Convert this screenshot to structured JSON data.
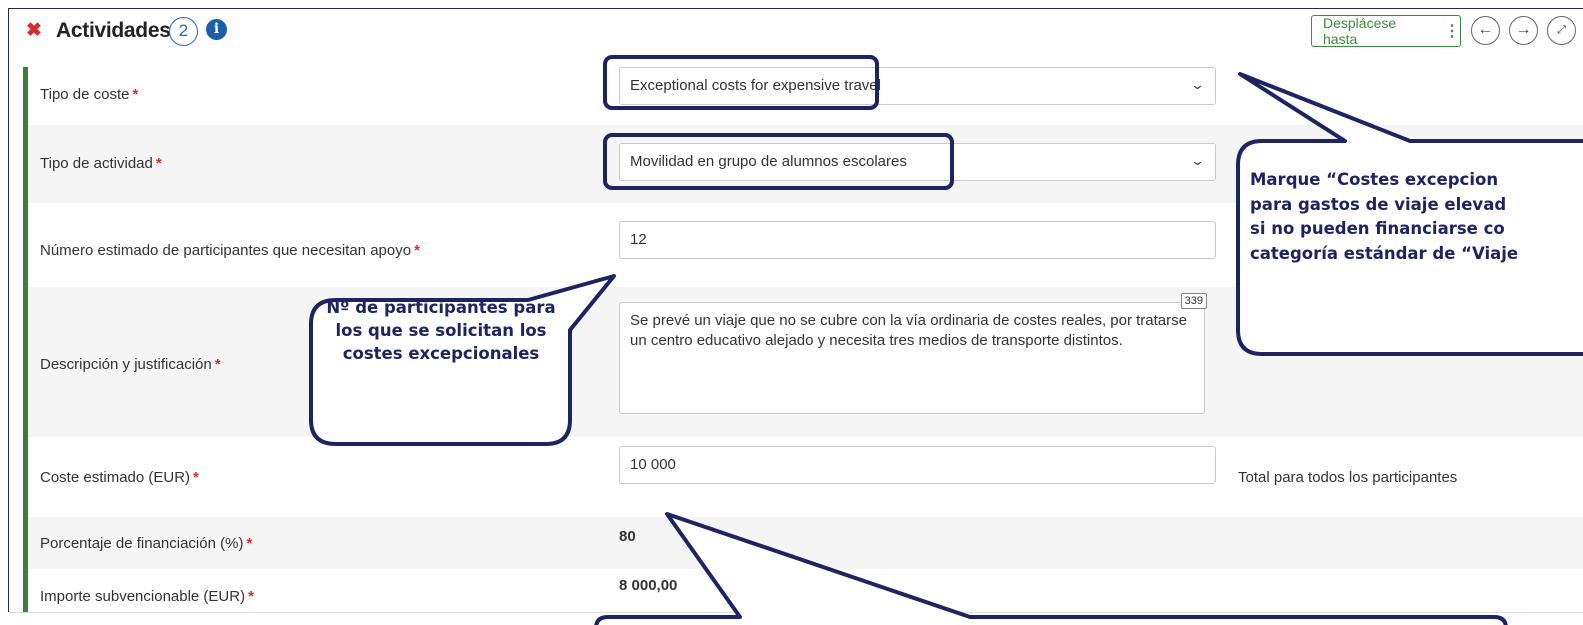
{
  "header": {
    "close_icon": "close-x-icon",
    "title": "Actividades",
    "count": "2",
    "info_icon": "info-circle-icon",
    "scroll_button_label": "Desplácese hasta",
    "scroll_menu_icon": "vertical-dots-icon",
    "prev_icon": "arrow-left-icon",
    "next_icon": "arrow-right-icon",
    "expand_icon": "expand-icon"
  },
  "form": {
    "cost_type": {
      "label": "Tipo de coste",
      "value": "Exceptional costs for expensive travel"
    },
    "activity_type": {
      "label": "Tipo de actividad",
      "value": "Movilidad en grupo de alumnos escolares"
    },
    "participants": {
      "label": "Número estimado de participantes que necesitan apoyo",
      "value": "12"
    },
    "description": {
      "label": "Descripción y justificación",
      "value": "Se prevé un viaje que no se cubre con la vía ordinaria de costes reales, por tratarse un centro educativo alejado y necesita tres medios de transporte distintos.",
      "char_counter": "339"
    },
    "estimated_cost": {
      "label": "Coste estimado (EUR)",
      "value": "10 000",
      "hint": "Total para todos los participantes"
    },
    "funding_pct": {
      "label": "Porcentaje de financiación (%)",
      "value": "80"
    },
    "eligible_amount": {
      "label": "Importe subvencionable (EUR)",
      "value": "8 000,00"
    },
    "required_mark": "*"
  },
  "callouts": {
    "participants_note": "Nº de participantes para los que se solicitan los costes excepcionales",
    "right_note_lines": [
      "Marque “Costes excepcion",
      "para gastos de viaje elevad",
      "si no pueden financiarse co",
      "categoría estándar de “Viaje"
    ]
  },
  "colors": {
    "accent_green": "#3b7d3b",
    "required_red": "#d62c2c",
    "callout_navy": "#1e2462",
    "badge_blue": "#2a6bb5"
  }
}
